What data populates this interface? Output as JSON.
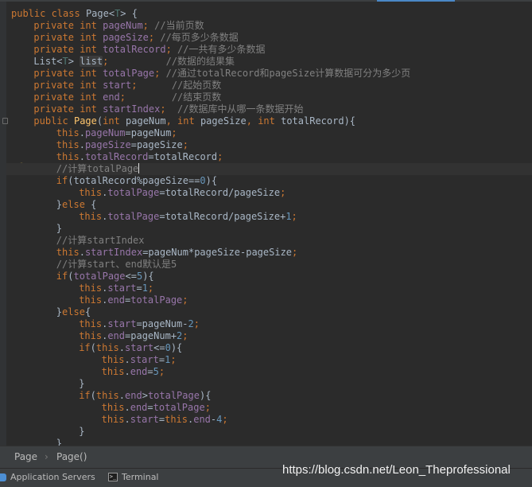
{
  "code_lines": [
    {
      "indent": 0,
      "tokens": [
        {
          "s": "k",
          "t": "public "
        },
        {
          "s": "k",
          "t": "class "
        },
        {
          "s": "p",
          "t": "Page<"
        },
        {
          "s": "t",
          "t": "T"
        },
        {
          "s": "p",
          "t": "> {"
        }
      ]
    },
    {
      "indent": 4,
      "tokens": [
        {
          "s": "k",
          "t": "private int "
        },
        {
          "s": "f",
          "t": "pageNum"
        },
        {
          "s": "k",
          "t": "; "
        },
        {
          "s": "c",
          "t": "//当前页数"
        }
      ]
    },
    {
      "indent": 4,
      "tokens": [
        {
          "s": "k",
          "t": "private int "
        },
        {
          "s": "f",
          "t": "pageSize"
        },
        {
          "s": "k",
          "t": "; "
        },
        {
          "s": "c",
          "t": "//每页多少条数据"
        }
      ]
    },
    {
      "indent": 4,
      "tokens": [
        {
          "s": "k",
          "t": "private int "
        },
        {
          "s": "f",
          "t": "totalRecord"
        },
        {
          "s": "k",
          "t": "; "
        },
        {
          "s": "c",
          "t": "//一共有多少条数据"
        }
      ]
    },
    {
      "indent": 4,
      "tokens": [
        {
          "s": "p",
          "t": "List<"
        },
        {
          "s": "t",
          "t": "T"
        },
        {
          "s": "p",
          "t": "> "
        },
        {
          "s": "u",
          "t": "list"
        },
        {
          "s": "k",
          "t": ";"
        },
        {
          "s": "p",
          "t": "          "
        },
        {
          "s": "c",
          "t": "//数据的结果集"
        }
      ]
    },
    {
      "indent": 4,
      "tokens": [
        {
          "s": "k",
          "t": "private int "
        },
        {
          "s": "f",
          "t": "totalPage"
        },
        {
          "s": "k",
          "t": "; "
        },
        {
          "s": "c",
          "t": "//通过totalRecord和pageSize计算数据可分为多少页"
        }
      ]
    },
    {
      "indent": 4,
      "tokens": [
        {
          "s": "k",
          "t": "private int "
        },
        {
          "s": "f",
          "t": "start"
        },
        {
          "s": "k",
          "t": ";"
        },
        {
          "s": "p",
          "t": "      "
        },
        {
          "s": "c",
          "t": "//起始页数"
        }
      ]
    },
    {
      "indent": 4,
      "tokens": [
        {
          "s": "k",
          "t": "private int "
        },
        {
          "s": "f",
          "t": "end"
        },
        {
          "s": "k",
          "t": ";"
        },
        {
          "s": "p",
          "t": "        "
        },
        {
          "s": "c",
          "t": "//结束页数"
        }
      ]
    },
    {
      "indent": 4,
      "tokens": [
        {
          "s": "k",
          "t": "private int "
        },
        {
          "s": "f",
          "t": "startIndex"
        },
        {
          "s": "k",
          "t": "; "
        },
        {
          "s": "p",
          "t": " "
        },
        {
          "s": "c",
          "t": "//数据库中从哪一条数据开始"
        }
      ]
    },
    {
      "indent": 4,
      "tokens": [
        {
          "s": "k",
          "t": "public "
        },
        {
          "s": "fn",
          "t": "Page"
        },
        {
          "s": "p",
          "t": "("
        },
        {
          "s": "k",
          "t": "int "
        },
        {
          "s": "p",
          "t": "pageNum"
        },
        {
          "s": "k",
          "t": ", int "
        },
        {
          "s": "p",
          "t": "pageSize"
        },
        {
          "s": "k",
          "t": ", int "
        },
        {
          "s": "p",
          "t": "totalRecord){"
        }
      ]
    },
    {
      "indent": 8,
      "tokens": [
        {
          "s": "k",
          "t": "this"
        },
        {
          "s": "p",
          "t": "."
        },
        {
          "s": "f",
          "t": "pageNum"
        },
        {
          "s": "p",
          "t": "=pageNum"
        },
        {
          "s": "k",
          "t": ";"
        }
      ]
    },
    {
      "indent": 8,
      "tokens": [
        {
          "s": "k",
          "t": "this"
        },
        {
          "s": "p",
          "t": "."
        },
        {
          "s": "f",
          "t": "pageSize"
        },
        {
          "s": "p",
          "t": "=pageSize"
        },
        {
          "s": "k",
          "t": ";"
        }
      ]
    },
    {
      "indent": 8,
      "tokens": [
        {
          "s": "k",
          "t": "this"
        },
        {
          "s": "p",
          "t": "."
        },
        {
          "s": "f",
          "t": "totalRecord"
        },
        {
          "s": "p",
          "t": "=totalRecord"
        },
        {
          "s": "k",
          "t": ";"
        }
      ]
    },
    {
      "indent": 8,
      "caret": true,
      "tokens": [
        {
          "s": "c",
          "t": "//计算totalPage"
        }
      ]
    },
    {
      "indent": 8,
      "tokens": [
        {
          "s": "k",
          "t": "if"
        },
        {
          "s": "p",
          "t": "(totalRecord%pageSize=="
        },
        {
          "s": "n",
          "t": "0"
        },
        {
          "s": "p",
          "t": "){"
        }
      ]
    },
    {
      "indent": 12,
      "tokens": [
        {
          "s": "k",
          "t": "this"
        },
        {
          "s": "p",
          "t": "."
        },
        {
          "s": "f",
          "t": "totalPage"
        },
        {
          "s": "p",
          "t": "=totalRecord/pageSize"
        },
        {
          "s": "k",
          "t": ";"
        }
      ]
    },
    {
      "indent": 8,
      "tokens": [
        {
          "s": "p",
          "t": "}"
        },
        {
          "s": "k",
          "t": "else "
        },
        {
          "s": "p",
          "t": "{"
        }
      ]
    },
    {
      "indent": 12,
      "tokens": [
        {
          "s": "k",
          "t": "this"
        },
        {
          "s": "p",
          "t": "."
        },
        {
          "s": "f",
          "t": "totalPage"
        },
        {
          "s": "p",
          "t": "=totalRecord/pageSize+"
        },
        {
          "s": "n",
          "t": "1"
        },
        {
          "s": "k",
          "t": ";"
        }
      ]
    },
    {
      "indent": 8,
      "tokens": [
        {
          "s": "p",
          "t": "}"
        }
      ]
    },
    {
      "indent": 8,
      "tokens": [
        {
          "s": "c",
          "t": "//计算startIndex"
        }
      ]
    },
    {
      "indent": 8,
      "tokens": [
        {
          "s": "k",
          "t": "this"
        },
        {
          "s": "p",
          "t": "."
        },
        {
          "s": "f",
          "t": "startIndex"
        },
        {
          "s": "p",
          "t": "=pageNum*pageSize-pageSize"
        },
        {
          "s": "k",
          "t": ";"
        }
      ]
    },
    {
      "indent": 8,
      "tokens": [
        {
          "s": "c",
          "t": "//计算start、end默认是5"
        }
      ]
    },
    {
      "indent": 8,
      "tokens": [
        {
          "s": "k",
          "t": "if"
        },
        {
          "s": "p",
          "t": "("
        },
        {
          "s": "f",
          "t": "totalPage"
        },
        {
          "s": "p",
          "t": "<="
        },
        {
          "s": "n",
          "t": "5"
        },
        {
          "s": "p",
          "t": "){"
        }
      ]
    },
    {
      "indent": 12,
      "tokens": [
        {
          "s": "k",
          "t": "this"
        },
        {
          "s": "p",
          "t": "."
        },
        {
          "s": "f",
          "t": "start"
        },
        {
          "s": "p",
          "t": "="
        },
        {
          "s": "n",
          "t": "1"
        },
        {
          "s": "k",
          "t": ";"
        }
      ]
    },
    {
      "indent": 12,
      "tokens": [
        {
          "s": "k",
          "t": "this"
        },
        {
          "s": "p",
          "t": "."
        },
        {
          "s": "f",
          "t": "end"
        },
        {
          "s": "p",
          "t": "="
        },
        {
          "s": "f",
          "t": "totalPage"
        },
        {
          "s": "k",
          "t": ";"
        }
      ]
    },
    {
      "indent": 8,
      "tokens": [
        {
          "s": "p",
          "t": "}"
        },
        {
          "s": "k",
          "t": "else"
        },
        {
          "s": "p",
          "t": "{"
        }
      ]
    },
    {
      "indent": 12,
      "tokens": [
        {
          "s": "k",
          "t": "this"
        },
        {
          "s": "p",
          "t": "."
        },
        {
          "s": "f",
          "t": "start"
        },
        {
          "s": "p",
          "t": "=pageNum-"
        },
        {
          "s": "n",
          "t": "2"
        },
        {
          "s": "k",
          "t": ";"
        }
      ]
    },
    {
      "indent": 12,
      "tokens": [
        {
          "s": "k",
          "t": "this"
        },
        {
          "s": "p",
          "t": "."
        },
        {
          "s": "f",
          "t": "end"
        },
        {
          "s": "p",
          "t": "=pageNum+"
        },
        {
          "s": "n",
          "t": "2"
        },
        {
          "s": "k",
          "t": ";"
        }
      ]
    },
    {
      "indent": 12,
      "tokens": [
        {
          "s": "k",
          "t": "if"
        },
        {
          "s": "p",
          "t": "("
        },
        {
          "s": "k",
          "t": "this"
        },
        {
          "s": "p",
          "t": "."
        },
        {
          "s": "f",
          "t": "start"
        },
        {
          "s": "p",
          "t": "<="
        },
        {
          "s": "n",
          "t": "0"
        },
        {
          "s": "p",
          "t": "){"
        }
      ]
    },
    {
      "indent": 16,
      "tokens": [
        {
          "s": "k",
          "t": "this"
        },
        {
          "s": "p",
          "t": "."
        },
        {
          "s": "f",
          "t": "start"
        },
        {
          "s": "p",
          "t": "="
        },
        {
          "s": "n",
          "t": "1"
        },
        {
          "s": "k",
          "t": ";"
        }
      ]
    },
    {
      "indent": 16,
      "tokens": [
        {
          "s": "k",
          "t": "this"
        },
        {
          "s": "p",
          "t": "."
        },
        {
          "s": "f",
          "t": "end"
        },
        {
          "s": "p",
          "t": "="
        },
        {
          "s": "n",
          "t": "5"
        },
        {
          "s": "k",
          "t": ";"
        }
      ]
    },
    {
      "indent": 12,
      "tokens": [
        {
          "s": "p",
          "t": "}"
        }
      ]
    },
    {
      "indent": 12,
      "tokens": [
        {
          "s": "k",
          "t": "if"
        },
        {
          "s": "p",
          "t": "("
        },
        {
          "s": "k",
          "t": "this"
        },
        {
          "s": "p",
          "t": "."
        },
        {
          "s": "f",
          "t": "end"
        },
        {
          "s": "p",
          "t": ">"
        },
        {
          "s": "f",
          "t": "totalPage"
        },
        {
          "s": "p",
          "t": "){"
        }
      ]
    },
    {
      "indent": 16,
      "tokens": [
        {
          "s": "k",
          "t": "this"
        },
        {
          "s": "p",
          "t": "."
        },
        {
          "s": "f",
          "t": "end"
        },
        {
          "s": "p",
          "t": "="
        },
        {
          "s": "f",
          "t": "totalPage"
        },
        {
          "s": "k",
          "t": ";"
        }
      ]
    },
    {
      "indent": 16,
      "tokens": [
        {
          "s": "k",
          "t": "this"
        },
        {
          "s": "p",
          "t": "."
        },
        {
          "s": "f",
          "t": "start"
        },
        {
          "s": "p",
          "t": "="
        },
        {
          "s": "k",
          "t": "this"
        },
        {
          "s": "p",
          "t": "."
        },
        {
          "s": "f",
          "t": "end"
        },
        {
          "s": "p",
          "t": "-"
        },
        {
          "s": "n",
          "t": "4"
        },
        {
          "s": "k",
          "t": ";"
        }
      ]
    },
    {
      "indent": 12,
      "tokens": [
        {
          "s": "p",
          "t": "}"
        }
      ]
    },
    {
      "indent": 8,
      "tokens": [
        {
          "s": "p",
          "t": "}"
        }
      ]
    }
  ],
  "breadcrumb": {
    "items": [
      "Page",
      "Page()"
    ],
    "separator": "›"
  },
  "tool_windows": {
    "app_servers": "Application Servers",
    "terminal": "Terminal",
    "terminal_icon_glyph": ">_"
  },
  "watermark": "https://blog.csdn.net/Leon_Theprofessional",
  "colors": {
    "editor_bg": "#2b2b2b",
    "keyword": "#cc7832",
    "field": "#9876aa",
    "comment": "#808080",
    "number": "#6897bb",
    "method": "#ffc66d",
    "plain": "#a9b7c6",
    "caret_line": "#323232"
  },
  "icons": [
    "fold-icon",
    "lightbulb-icon",
    "app-servers-icon",
    "terminal-icon"
  ]
}
